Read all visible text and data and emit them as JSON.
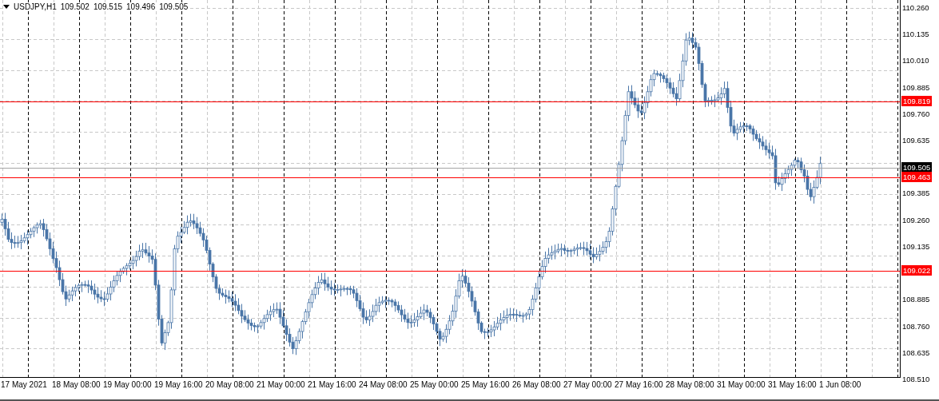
{
  "chart": {
    "symbol": "USDJPY,H1",
    "ohlc": [
      "109.502",
      "109.515",
      "109.496",
      "109.505"
    ],
    "price_ticks": [
      "110.260",
      "110.135",
      "110.010",
      "109.885",
      "109.760",
      "109.635",
      "109.385",
      "109.260",
      "109.135",
      "108.885",
      "108.760",
      "108.635",
      "108.510"
    ],
    "time_labels": [
      "17 May 2021",
      "18 May 08:00",
      "19 May 00:00",
      "19 May 16:00",
      "20 May 08:00",
      "21 May 00:00",
      "21 May 16:00",
      "24 May 08:00",
      "25 May 00:00",
      "25 May 16:00",
      "26 May 08:00",
      "27 May 00:00",
      "27 May 16:00",
      "28 May 08:00",
      "31 May 00:00",
      "31 May 16:00",
      "1 Jun 08:00"
    ],
    "levels": [
      {
        "price": "109.819",
        "color": "#ff0000"
      },
      {
        "price": "109.463",
        "color": "#ff0000"
      },
      {
        "price": "109.022",
        "color": "#ff0000"
      }
    ],
    "current_price": "109.505"
  }
}
